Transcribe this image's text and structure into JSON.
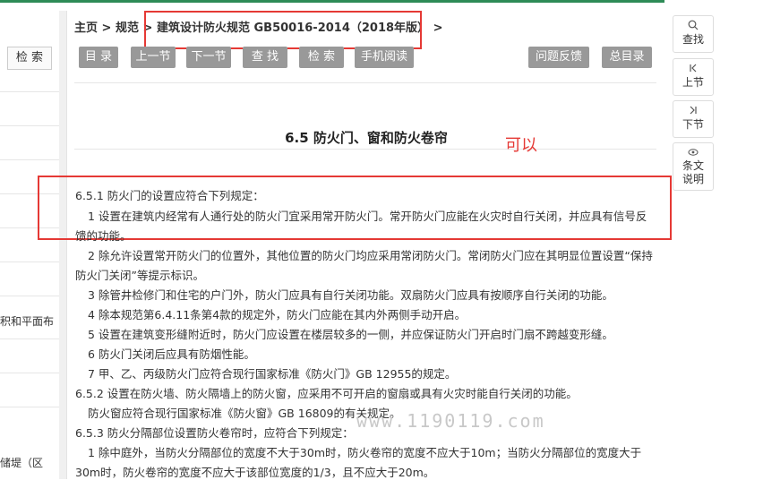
{
  "left": {
    "search_label": "检 索",
    "frag_area": "积和平面布",
    "frag_dike": "储堤（区"
  },
  "breadcrumb": {
    "home": "主页",
    "sep1": ">",
    "category": "规范",
    "sep2": ">",
    "doc": "建筑设计防火规范 GB50016-2014（2018年版）",
    "sep3": ">"
  },
  "toolbar": {
    "catalog": "目 录",
    "prev": "上一节",
    "next": "下一节",
    "find": "查 找",
    "search": "检 索",
    "mobile": "手机阅读",
    "feedback": "问题反馈",
    "toc": "总目录"
  },
  "section": {
    "title": "6.5 防火门、窗和防火卷帘",
    "annotation": "可以"
  },
  "content": {
    "l1": "6.5.1 防火门的设置应符合下列规定：",
    "l2": "1 设置在建筑内经常有人通行处的防火门宜采用常开防火门。常开防火门应能在火灾时自行关闭，并应具有信号反",
    "l3": "馈的功能。",
    "l4": "2 除允许设置常开防火门的位置外，其他位置的防火门均应采用常闭防火门。常闭防火门应在其明显位置设置“保持",
    "l5": "防火门关闭”等提示标识。",
    "l6": "3 除管井检修门和住宅的户门外，防火门应具有自行关闭功能。双扇防火门应具有按顺序自行关闭的功能。",
    "l7": "4 除本规范第6.4.11条第4款的规定外，防火门应能在其内外两侧手动开启。",
    "l8": "5 设置在建筑变形缝附近时，防火门应设置在楼层较多的一侧，并应保证防火门开启时门扇不跨越变形缝。",
    "l9": "6 防火门关闭后应具有防烟性能。",
    "l10": "7 甲、乙、丙级防火门应符合现行国家标准《防火门》GB 12955的规定。",
    "l11": "6.5.2 设置在防火墙、防火隔墙上的防火窗，应采用不可开启的窗扇或具有火灾时能自行关闭的功能。",
    "l12": "防火窗应符合现行国家标准《防火窗》GB 16809的有关规定。",
    "l13": "6.5.3 防火分隔部位设置防火卷帘时，应符合下列规定：",
    "l14": "1 除中庭外，当防火分隔部位的宽度不大于30m时，防火卷帘的宽度不应大于10m；当防火分隔部位的宽度大于",
    "l15": "30m时，防火卷帘的宽度不应大于该部位宽度的1/3，且不应大于20m。"
  },
  "watermark": "www.1190119.com",
  "right_tools": {
    "find": "查找",
    "prev": "上节",
    "next": "下节",
    "explain1": "条文",
    "explain2": "说明"
  },
  "colors": {
    "accent_bar": "#2e8b57",
    "button_gray": "#999999",
    "annotation_red": "#e53935"
  }
}
